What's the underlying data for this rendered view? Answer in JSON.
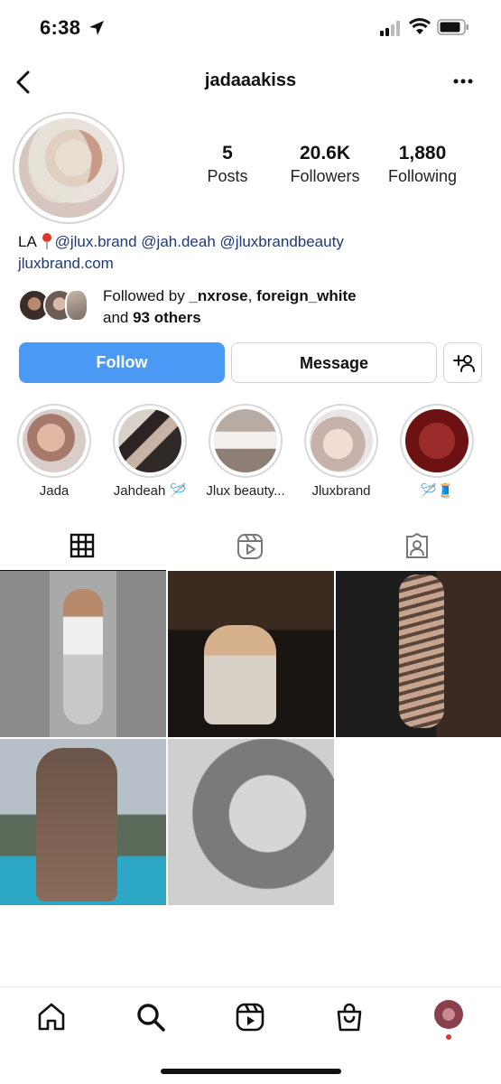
{
  "status_bar": {
    "time": "6:38"
  },
  "header": {
    "username": "jadaaakiss"
  },
  "stats": [
    {
      "value": "5",
      "label": "Posts"
    },
    {
      "value": "20.6K",
      "label": "Followers"
    },
    {
      "value": "1,880",
      "label": "Following"
    }
  ],
  "bio": {
    "line1_prefix": "LA",
    "mentions": [
      "@jlux.brand",
      "@jah.deah",
      "@jluxbrandbeauty"
    ],
    "link": "jluxbrand.com"
  },
  "followed_by": {
    "prefix": "Followed by ",
    "user1": "_nxrose",
    "sep": ", ",
    "user2": "foreign_white",
    "and": "and ",
    "others": "93 others"
  },
  "buttons": {
    "follow": "Follow",
    "message": "Message"
  },
  "highlights": [
    {
      "label": "Jada"
    },
    {
      "label": "Jahdeah 🪡"
    },
    {
      "label": "Jlux beauty..."
    },
    {
      "label": "Jluxbrand"
    },
    {
      "label": "🪡🧵"
    }
  ],
  "colors": {
    "follow_button": "#4a9af5",
    "mention": "#1e3a78"
  }
}
